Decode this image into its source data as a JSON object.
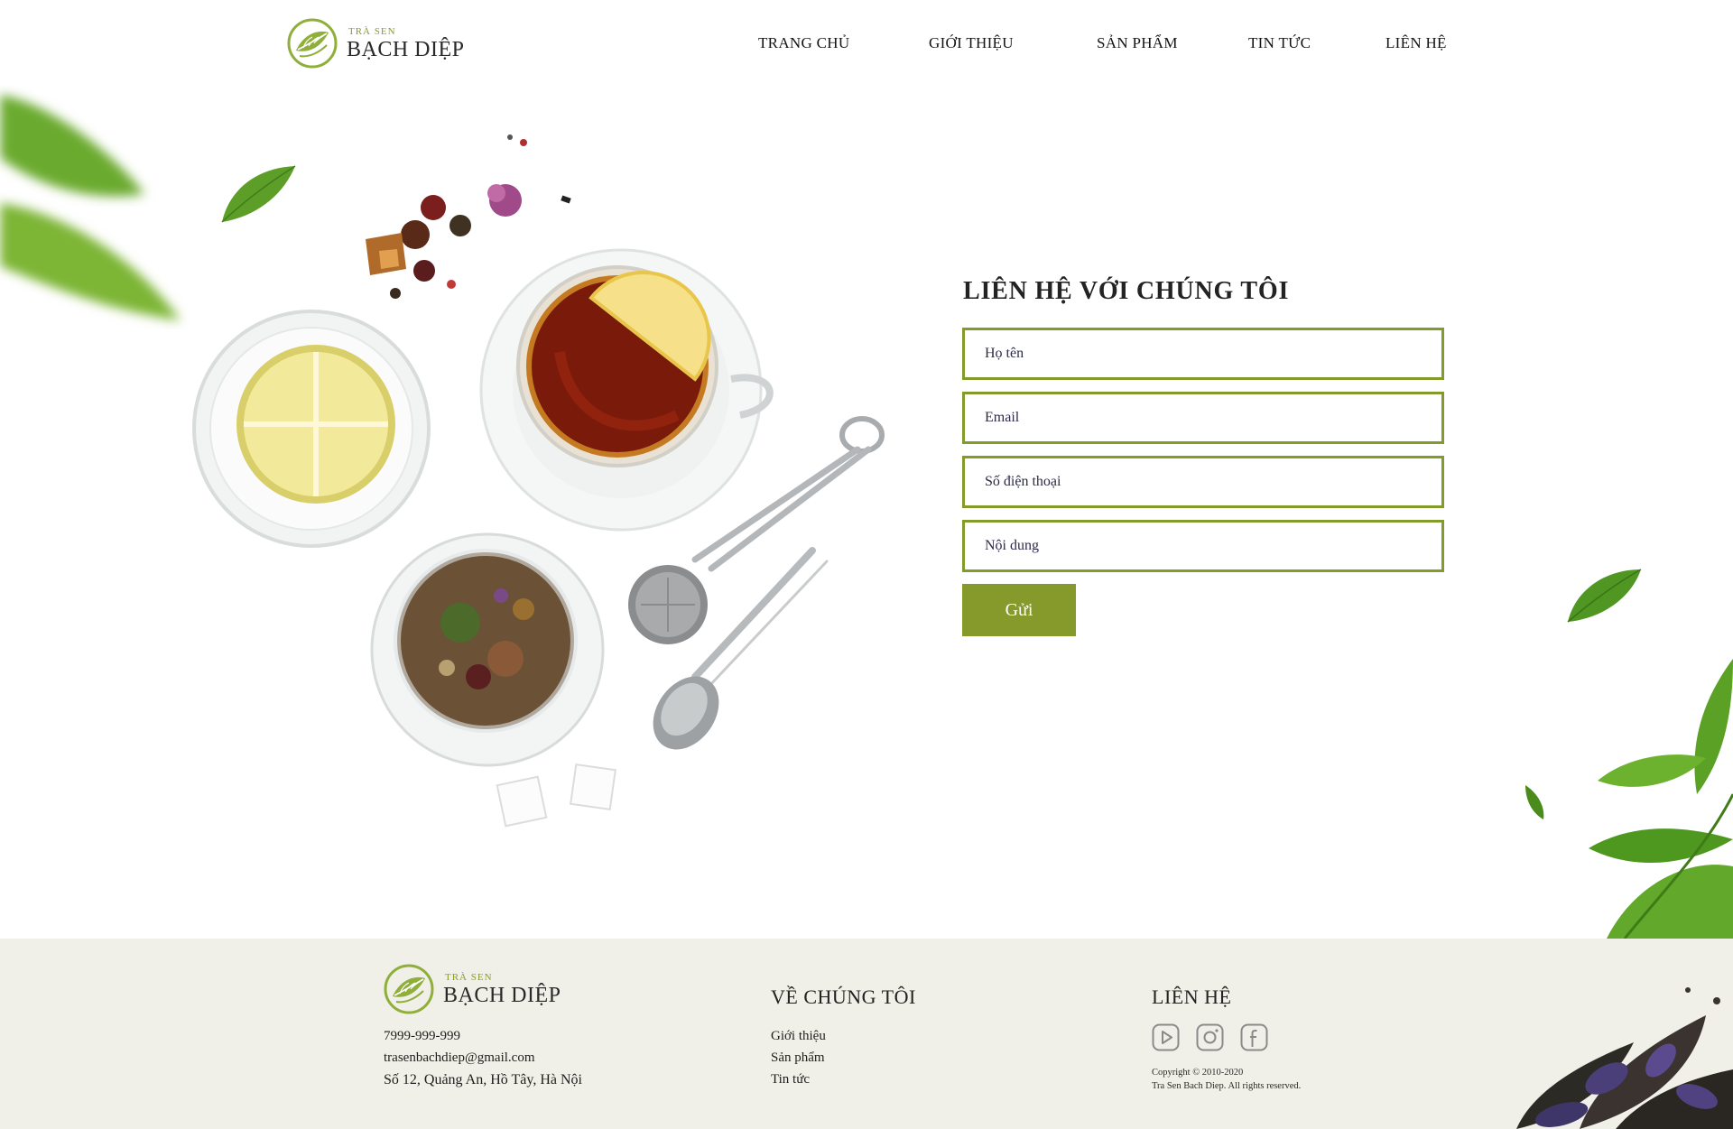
{
  "brand": {
    "small": "TRÀ SEN",
    "name": "BẠCH DIỆP"
  },
  "nav": {
    "items": [
      {
        "label": "TRANG CHỦ"
      },
      {
        "label": "GIỚI THIỆU"
      },
      {
        "label": "SẢN PHẨM"
      },
      {
        "label": "TIN TỨC"
      },
      {
        "label": "LIÊN HỆ"
      }
    ]
  },
  "contact": {
    "title": "LIÊN HỆ VỚI CHÚNG TÔI",
    "fields": {
      "name": "Họ tên",
      "email": "Email",
      "phone": "Số điện thoại",
      "message": "Nội dung"
    },
    "submit_label": "Gửi"
  },
  "footer": {
    "phone": "7999-999-999",
    "email": "trasenbachdiep@gmail.com",
    "address": "Số 12, Quảng An, Hồ Tây, Hà Nội",
    "about_title": "VỀ CHÚNG TÔI",
    "about_links": [
      "Giới thiệu",
      "Sản phẩm",
      "Tin tức"
    ],
    "contact_title": "LIÊN HỆ",
    "socials": [
      "youtube-icon",
      "instagram-icon",
      "facebook-icon"
    ],
    "copyright_line1": "Copyright © 2010-2020",
    "copyright_line2": "Tra Sen Bach Diep. All rights reserved."
  },
  "colors": {
    "accent": "#86992b",
    "footer_bg": "#f0f0e8",
    "leaf": "#5fa82a"
  }
}
